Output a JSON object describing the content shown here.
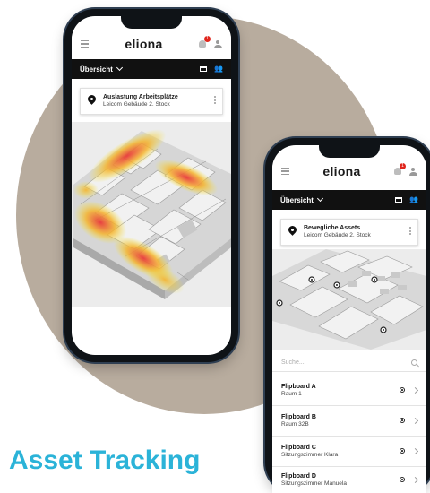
{
  "brand": {
    "logo_text": "eliona",
    "accent_color": "#2bb3d8",
    "badge_color": "#e0261d"
  },
  "headline": "Asset Tracking",
  "phone_left": {
    "menu_icon": "hamburger-icon",
    "notification_icon": "bell-icon",
    "notification_count": "1",
    "user_icon": "user-icon",
    "toolbar": {
      "view_label": "Übersicht",
      "icons": [
        "window-icon",
        "people-icon"
      ]
    },
    "card": {
      "title": "Auslastung Arbeitsplätze",
      "subtitle": "Leicom Gebäude 2. Stock",
      "icon": "location-pin-icon"
    },
    "map": {
      "type": "occupancy-heatmap",
      "heat_colors": [
        "#e8383a",
        "#f5b42e",
        "#f3e63b"
      ]
    }
  },
  "phone_right": {
    "menu_icon": "hamburger-icon",
    "notification_icon": "bell-icon",
    "notification_count": "1",
    "user_icon": "user-icon",
    "toolbar": {
      "view_label": "Übersicht",
      "icons": [
        "window-icon",
        "people-icon"
      ]
    },
    "card": {
      "title": "Bewegliche Assets",
      "subtitle": "Leicom Gebäude 2. Stock",
      "icon": "location-pin-icon"
    },
    "search": {
      "placeholder": "Suche..."
    },
    "assets": [
      {
        "name": "Flipboard A",
        "location": "Raum 1"
      },
      {
        "name": "Flipboard B",
        "location": "Raum 32B"
      },
      {
        "name": "Flipboard C",
        "location": "Sitzungszimmer Klara"
      },
      {
        "name": "Flipboard D",
        "location": "Sitzungszimmer Manuela"
      }
    ]
  }
}
